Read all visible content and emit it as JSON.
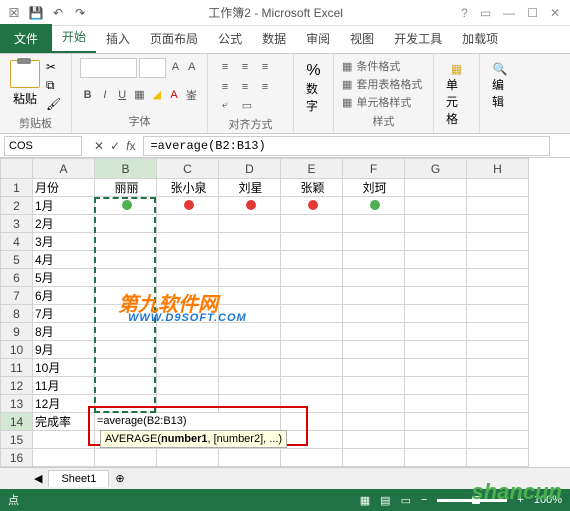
{
  "window": {
    "title": "工作簿2 - Microsoft Excel"
  },
  "tabs": {
    "file": "文件",
    "items": [
      "开始",
      "插入",
      "页面布局",
      "公式",
      "数据",
      "审阅",
      "视图",
      "开发工具",
      "加载项"
    ],
    "active": 0
  },
  "ribbon": {
    "paste": "粘贴",
    "clipboard_label": "剪贴板",
    "font_label": "字体",
    "align_label": "对齐方式",
    "num": "数字",
    "styles": {
      "cond": "条件格式",
      "table": "套用表格格式",
      "cell": "单元格样式",
      "label": "样式"
    },
    "cells": "单元格",
    "edit": "编辑"
  },
  "namebox": "COS",
  "formula": "=average(B2:B13)",
  "columns": [
    "A",
    "B",
    "C",
    "D",
    "E",
    "F",
    "G",
    "H"
  ],
  "headers": {
    "a": "月份",
    "b": "丽丽",
    "c": "张小泉",
    "d": "刘星",
    "e": "张颖",
    "f": "刘珂"
  },
  "months": [
    "1月",
    "2月",
    "3月",
    "4月",
    "5月",
    "6月",
    "7月",
    "8月",
    "9月",
    "10月",
    "11月",
    "12月"
  ],
  "summary_label": "完成率",
  "cell_formula": "=average(B2:B13)",
  "tooltip": {
    "fn": "AVERAGE(",
    "arg1": "number1",
    "rest": ", [number2], ...)"
  },
  "watermarks": {
    "soft": "第九软件网",
    "url": "WWW.D9SOFT.COM",
    "site": "shancun"
  },
  "sheet": "Sheet1",
  "status": {
    "mode": "点",
    "zoom": "100%"
  }
}
